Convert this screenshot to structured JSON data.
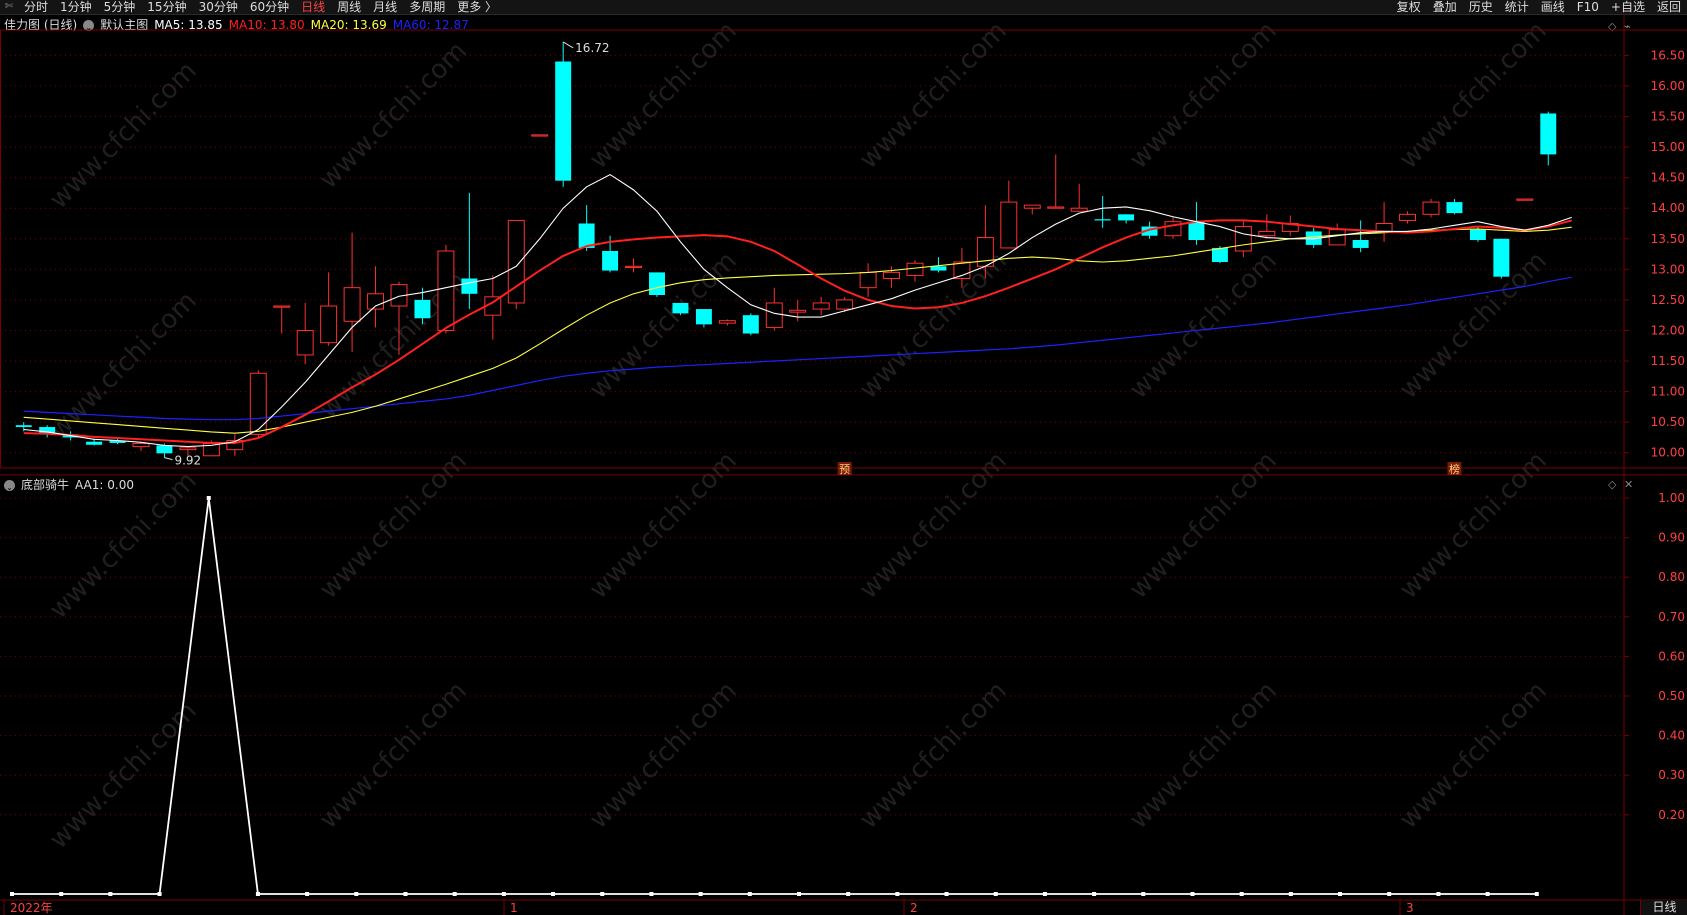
{
  "toolbar": {
    "corner": "✄",
    "left": [
      "分时",
      "1分钟",
      "5分钟",
      "15分钟",
      "30分钟",
      "60分钟",
      "日线",
      "周线",
      "月线",
      "多周期",
      "更多 〉"
    ],
    "active": "日线",
    "right": [
      "复权",
      "叠加",
      "历史",
      "统计",
      "画线",
      "F10",
      "+自选",
      "返回"
    ]
  },
  "main_legend": {
    "title": "佳力图 (日线)",
    "template": "默认主图",
    "ma5": "MA5: 13.85",
    "ma10": "MA10: 13.80",
    "ma20": "MA20: 13.69",
    "ma60": "MA60: 12.87"
  },
  "sub_legend": {
    "indicator": "底部骑牛",
    "value": "AA1: 0.00"
  },
  "colors": {
    "up": "#ff3030",
    "down": "#00ffff",
    "ma5": "#ffffff",
    "ma10": "#ff2020",
    "ma20": "#ffff40",
    "ma60": "#2020ff",
    "grid": "#7a0000",
    "axis_text": "#ff4040"
  },
  "annotations": {
    "high_label": "16.72",
    "low_label": "9.92",
    "mark1": "预",
    "mark2": "榜"
  },
  "period_label": "日线",
  "date_labels": [
    "2022年",
    "1",
    "2",
    "3"
  ],
  "watermark": "www.cfchi.com",
  "chart_data": [
    {
      "type": "candlestick",
      "title": "佳力图 (日线)",
      "y_ticks": [
        "16.50",
        "16.00",
        "15.50",
        "15.00",
        "14.50",
        "14.00",
        "13.50",
        "13.00",
        "12.50",
        "12.00",
        "11.50",
        "11.00",
        "10.50",
        "10.00"
      ],
      "ylim": [
        9.75,
        16.85
      ],
      "candles": [
        {
          "o": 10.45,
          "h": 10.5,
          "l": 10.35,
          "c": 10.42
        },
        {
          "o": 10.42,
          "h": 10.45,
          "l": 10.25,
          "c": 10.3
        },
        {
          "o": 10.3,
          "h": 10.35,
          "l": 10.2,
          "c": 10.25
        },
        {
          "o": 10.18,
          "h": 10.23,
          "l": 10.12,
          "c": 10.13
        },
        {
          "o": 10.2,
          "h": 10.24,
          "l": 10.14,
          "c": 10.16
        },
        {
          "o": 10.1,
          "h": 10.18,
          "l": 10.03,
          "c": 10.15
        },
        {
          "o": 10.12,
          "h": 10.15,
          "l": 9.92,
          "c": 9.99
        },
        {
          "o": 10.05,
          "h": 10.1,
          "l": 9.95,
          "c": 10.08
        },
        {
          "o": 9.95,
          "h": 10.2,
          "l": 9.95,
          "c": 10.15
        },
        {
          "o": 10.05,
          "h": 10.3,
          "l": 9.95,
          "c": 10.2
        },
        {
          "o": 10.3,
          "h": 11.35,
          "l": 10.25,
          "c": 11.3
        },
        {
          "o": 12.4,
          "h": 12.4,
          "l": 11.95,
          "c": 12.4
        },
        {
          "o": 11.6,
          "h": 12.45,
          "l": 11.45,
          "c": 12.0
        },
        {
          "o": 11.8,
          "h": 12.95,
          "l": 11.75,
          "c": 12.4
        },
        {
          "o": 12.15,
          "h": 13.6,
          "l": 11.65,
          "c": 12.7
        },
        {
          "o": 12.35,
          "h": 13.05,
          "l": 12.05,
          "c": 12.6
        },
        {
          "o": 12.4,
          "h": 12.8,
          "l": 11.6,
          "c": 12.75
        },
        {
          "o": 12.5,
          "h": 12.7,
          "l": 12.1,
          "c": 12.2
        },
        {
          "o": 12.0,
          "h": 13.4,
          "l": 11.95,
          "c": 13.3
        },
        {
          "o": 12.85,
          "h": 14.25,
          "l": 12.35,
          "c": 12.6
        },
        {
          "o": 12.25,
          "h": 12.9,
          "l": 11.85,
          "c": 12.55
        },
        {
          "o": 12.45,
          "h": 13.8,
          "l": 12.35,
          "c": 13.8
        },
        {
          "o": 15.2,
          "h": 15.2,
          "l": 15.2,
          "c": 15.2
        },
        {
          "o": 16.4,
          "h": 16.72,
          "l": 14.35,
          "c": 14.45
        },
        {
          "o": 13.75,
          "h": 14.05,
          "l": 13.3,
          "c": 13.35
        },
        {
          "o": 13.3,
          "h": 13.55,
          "l": 12.95,
          "c": 12.98
        },
        {
          "o": 13.05,
          "h": 13.18,
          "l": 12.95,
          "c": 13.05
        },
        {
          "o": 12.95,
          "h": 12.95,
          "l": 12.55,
          "c": 12.58
        },
        {
          "o": 12.45,
          "h": 12.45,
          "l": 12.25,
          "c": 12.28
        },
        {
          "o": 12.35,
          "h": 12.35,
          "l": 12.05,
          "c": 12.1
        },
        {
          "o": 12.12,
          "h": 12.18,
          "l": 12.08,
          "c": 12.16
        },
        {
          "o": 12.25,
          "h": 12.28,
          "l": 11.92,
          "c": 11.95
        },
        {
          "o": 12.05,
          "h": 12.7,
          "l": 12.0,
          "c": 12.45
        },
        {
          "o": 12.3,
          "h": 12.5,
          "l": 12.15,
          "c": 12.33
        },
        {
          "o": 12.35,
          "h": 12.55,
          "l": 12.25,
          "c": 12.45
        },
        {
          "o": 12.35,
          "h": 12.55,
          "l": 12.3,
          "c": 12.5
        },
        {
          "o": 12.7,
          "h": 13.1,
          "l": 12.55,
          "c": 12.95
        },
        {
          "o": 12.85,
          "h": 13.05,
          "l": 12.7,
          "c": 12.95
        },
        {
          "o": 12.9,
          "h": 13.15,
          "l": 12.8,
          "c": 13.1
        },
        {
          "o": 13.05,
          "h": 13.2,
          "l": 12.95,
          "c": 12.98
        },
        {
          "o": 12.85,
          "h": 13.35,
          "l": 12.7,
          "c": 13.12
        },
        {
          "o": 13.05,
          "h": 14.05,
          "l": 12.85,
          "c": 13.52
        },
        {
          "o": 13.35,
          "h": 14.45,
          "l": 13.35,
          "c": 14.1
        },
        {
          "o": 14.0,
          "h": 14.05,
          "l": 13.9,
          "c": 14.05
        },
        {
          "o": 14.0,
          "h": 14.88,
          "l": 14.0,
          "c": 14.02
        },
        {
          "o": 13.95,
          "h": 14.4,
          "l": 13.95,
          "c": 14.0
        },
        {
          "o": 13.82,
          "h": 14.2,
          "l": 13.68,
          "c": 13.8
        },
        {
          "o": 13.9,
          "h": 13.9,
          "l": 13.75,
          "c": 13.8
        },
        {
          "o": 13.7,
          "h": 13.78,
          "l": 13.5,
          "c": 13.55
        },
        {
          "o": 13.55,
          "h": 13.85,
          "l": 13.5,
          "c": 13.78
        },
        {
          "o": 13.78,
          "h": 14.1,
          "l": 13.4,
          "c": 13.48
        },
        {
          "o": 13.35,
          "h": 13.38,
          "l": 13.1,
          "c": 13.12
        },
        {
          "o": 13.3,
          "h": 13.8,
          "l": 13.2,
          "c": 13.7
        },
        {
          "o": 13.55,
          "h": 13.9,
          "l": 13.5,
          "c": 13.62
        },
        {
          "o": 13.62,
          "h": 13.88,
          "l": 13.55,
          "c": 13.75
        },
        {
          "o": 13.62,
          "h": 13.68,
          "l": 13.35,
          "c": 13.4
        },
        {
          "o": 13.4,
          "h": 13.75,
          "l": 13.4,
          "c": 13.65
        },
        {
          "o": 13.48,
          "h": 13.8,
          "l": 13.28,
          "c": 13.35
        },
        {
          "o": 13.62,
          "h": 14.1,
          "l": 13.45,
          "c": 13.75
        },
        {
          "o": 13.8,
          "h": 13.95,
          "l": 13.75,
          "c": 13.9
        },
        {
          "o": 13.9,
          "h": 14.15,
          "l": 13.85,
          "c": 14.1
        },
        {
          "o": 14.1,
          "h": 14.15,
          "l": 13.9,
          "c": 13.92
        },
        {
          "o": 13.65,
          "h": 13.7,
          "l": 13.45,
          "c": 13.48
        },
        {
          "o": 13.5,
          "h": 13.5,
          "l": 12.85,
          "c": 12.88
        },
        {
          "o": 14.15,
          "h": 14.15,
          "l": 14.15,
          "c": 14.15
        },
        {
          "o": 15.55,
          "h": 15.58,
          "l": 14.7,
          "c": 14.88
        }
      ],
      "ma5": [
        10.38,
        10.34,
        10.28,
        10.22,
        10.2,
        10.17,
        10.12,
        10.1,
        10.12,
        10.18,
        10.38,
        10.75,
        11.15,
        11.6,
        12.05,
        12.4,
        12.56,
        12.62,
        12.7,
        12.78,
        12.85,
        13.05,
        13.5,
        14.0,
        14.35,
        14.55,
        14.3,
        13.95,
        13.45,
        13.0,
        12.7,
        12.42,
        12.28,
        12.22,
        12.22,
        12.32,
        12.42,
        12.52,
        12.66,
        12.78,
        12.9,
        13.05,
        13.26,
        13.52,
        13.74,
        13.92,
        14.0,
        14.02,
        13.96,
        13.86,
        13.78,
        13.7,
        13.58,
        13.52,
        13.5,
        13.5,
        13.55,
        13.6,
        13.62,
        13.62,
        13.66,
        13.72,
        13.78,
        13.7,
        13.64,
        13.72,
        13.85
      ],
      "ma10": [
        10.32,
        10.31,
        10.29,
        10.26,
        10.24,
        10.22,
        10.2,
        10.18,
        10.16,
        10.16,
        10.24,
        10.42,
        10.62,
        10.84,
        11.07,
        11.28,
        11.52,
        11.78,
        12.04,
        12.26,
        12.46,
        12.72,
        12.98,
        13.22,
        13.38,
        13.45,
        13.49,
        13.52,
        13.54,
        13.56,
        13.54,
        13.45,
        13.3,
        13.08,
        12.85,
        12.65,
        12.5,
        12.4,
        12.36,
        12.38,
        12.45,
        12.56,
        12.7,
        12.85,
        13.0,
        13.18,
        13.36,
        13.52,
        13.65,
        13.72,
        13.78,
        13.8,
        13.8,
        13.78,
        13.74,
        13.7,
        13.66,
        13.64,
        13.62,
        13.6,
        13.62,
        13.66,
        13.7,
        13.68,
        13.64,
        13.7,
        13.8
      ],
      "ma20": [
        10.58,
        10.55,
        10.52,
        10.49,
        10.46,
        10.43,
        10.4,
        10.37,
        10.34,
        10.32,
        10.35,
        10.42,
        10.5,
        10.58,
        10.66,
        10.76,
        10.88,
        11.0,
        11.12,
        11.25,
        11.38,
        11.55,
        11.78,
        12.02,
        12.25,
        12.45,
        12.6,
        12.7,
        12.78,
        12.83,
        12.86,
        12.88,
        12.9,
        12.91,
        12.92,
        12.93,
        12.95,
        12.98,
        13.02,
        13.06,
        13.1,
        13.14,
        13.18,
        13.2,
        13.18,
        13.14,
        13.12,
        13.14,
        13.18,
        13.22,
        13.28,
        13.34,
        13.4,
        13.45,
        13.5,
        13.53,
        13.56,
        13.58,
        13.6,
        13.62,
        13.64,
        13.65,
        13.66,
        13.64,
        13.62,
        13.64,
        13.69
      ],
      "ma60": [
        10.68,
        10.66,
        10.64,
        10.62,
        10.6,
        10.58,
        10.56,
        10.55,
        10.54,
        10.54,
        10.56,
        10.6,
        10.64,
        10.68,
        10.72,
        10.76,
        10.8,
        10.84,
        10.88,
        10.94,
        11.02,
        11.1,
        11.18,
        11.25,
        11.3,
        11.34,
        11.37,
        11.4,
        11.42,
        11.44,
        11.46,
        11.48,
        11.5,
        11.52,
        11.54,
        11.56,
        11.58,
        11.6,
        11.62,
        11.64,
        11.66,
        11.68,
        11.7,
        11.73,
        11.76,
        11.8,
        11.84,
        11.88,
        11.92,
        11.96,
        12.0,
        12.04,
        12.08,
        12.12,
        12.17,
        12.22,
        12.27,
        12.32,
        12.37,
        12.42,
        12.48,
        12.54,
        12.6,
        12.66,
        12.72,
        12.8,
        12.87
      ]
    },
    {
      "type": "line",
      "title": "底部骑牛",
      "y_ticks": [
        "1.00",
        "0.90",
        "0.80",
        "0.70",
        "0.60",
        "0.50",
        "0.40",
        "0.30",
        "0.20"
      ],
      "ylim": [
        0,
        1.0
      ],
      "series": [
        {
          "name": "AA1",
          "values": [
            0,
            0,
            0,
            0,
            1,
            0,
            0,
            0,
            0,
            0,
            0,
            0,
            0,
            0,
            0,
            0,
            0,
            0,
            0,
            0,
            0,
            0,
            0,
            0,
            0,
            0,
            0,
            0,
            0,
            0,
            0,
            0
          ]
        }
      ]
    }
  ]
}
